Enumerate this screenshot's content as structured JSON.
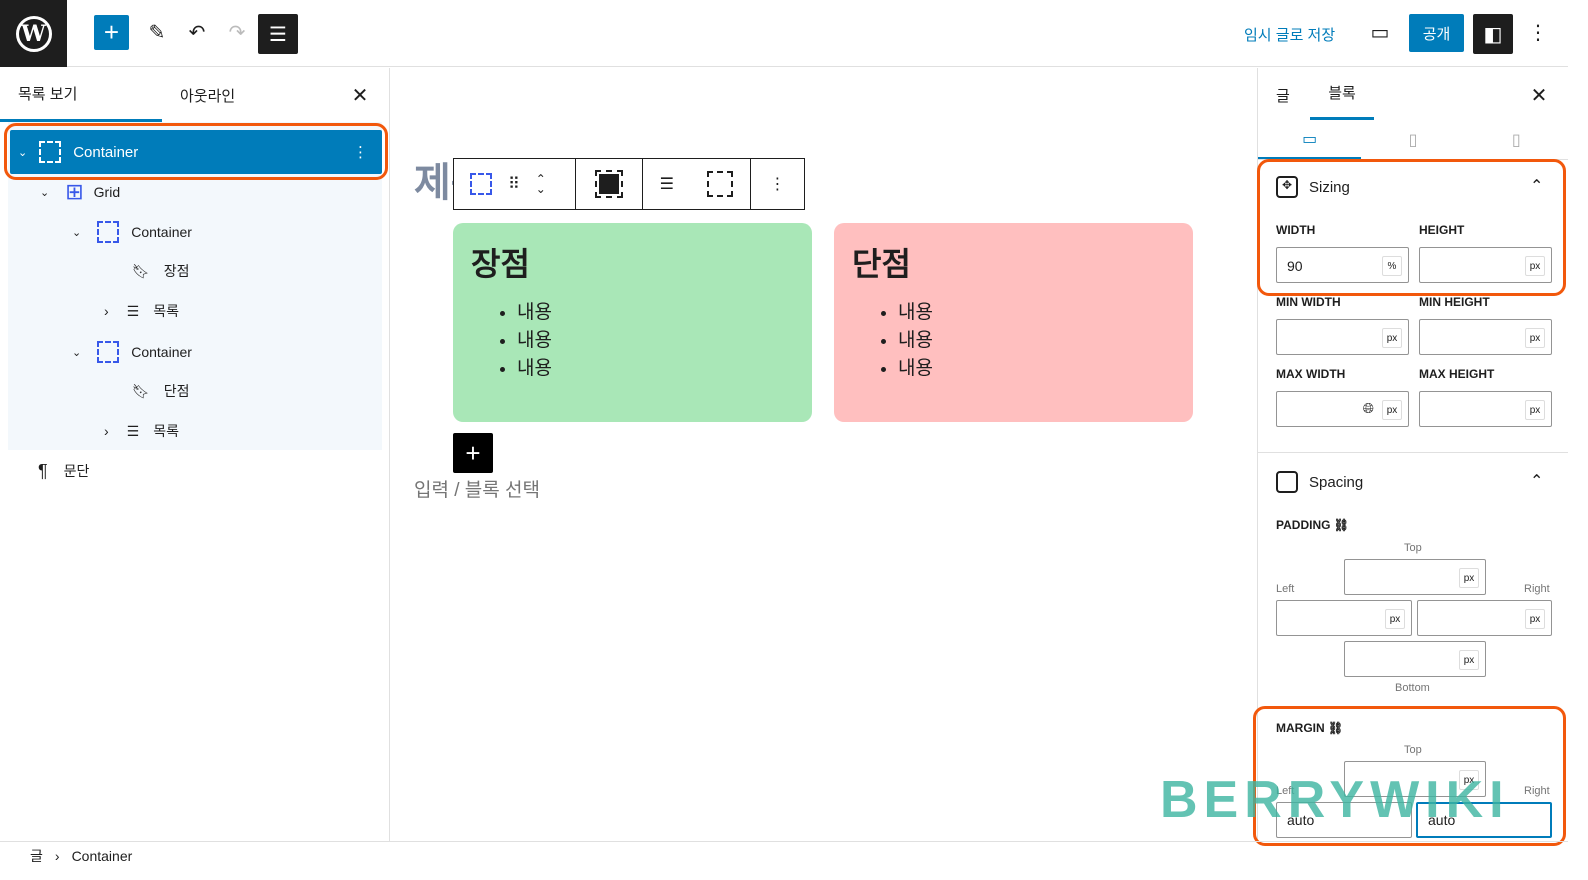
{
  "topbar": {
    "save_draft": "임시 글로 저장",
    "publish": "공개",
    "accent": "#007cba"
  },
  "left_panel": {
    "tabs": [
      "목록 보기",
      "아웃라인"
    ],
    "tree": [
      {
        "label": "Container",
        "icon": "container-icon",
        "level": 0,
        "selected": true
      },
      {
        "label": "Grid",
        "icon": "grid-icon",
        "level": 1
      },
      {
        "label": "Container",
        "icon": "container-icon",
        "level": 2
      },
      {
        "label": "장점",
        "icon": "heading-icon",
        "level": 3
      },
      {
        "label": "목록",
        "icon": "list-icon",
        "level": 3
      },
      {
        "label": "Container",
        "icon": "container-icon",
        "level": 2
      },
      {
        "label": "단점",
        "icon": "heading-icon",
        "level": 3
      },
      {
        "label": "목록",
        "icon": "list-icon",
        "level": 3
      },
      {
        "label": "문단",
        "icon": "paragraph-icon",
        "level": 0
      }
    ]
  },
  "editor": {
    "title": "제목 추가",
    "cards": [
      {
        "heading": "장점",
        "items": [
          "내용",
          "내용",
          "내용"
        ],
        "color": "#a9e7b7"
      },
      {
        "heading": "단점",
        "items": [
          "내용",
          "내용",
          "내용"
        ],
        "color": "#ffbfbf"
      }
    ],
    "placeholder": "입력 / 블록 선택"
  },
  "right_panel": {
    "tabs": [
      "글",
      "블록"
    ],
    "sizing": {
      "title": "Sizing",
      "width_label": "WIDTH",
      "width_value": "90",
      "width_unit": "%",
      "height_label": "HEIGHT",
      "min_width": "MIN WIDTH",
      "min_height": "MIN HEIGHT",
      "max_width": "MAX WIDTH",
      "max_height": "MAX HEIGHT",
      "unit": "px"
    },
    "spacing": {
      "title": "Spacing",
      "padding": "PADDING",
      "margin": "MARGIN",
      "top": "Top",
      "left": "Left",
      "right": "Right",
      "bottom": "Bottom",
      "margin_left": "auto",
      "margin_right": "auto"
    }
  },
  "status": {
    "crumbs": [
      "글",
      "Container"
    ]
  },
  "watermark": "BERRYWIKI"
}
